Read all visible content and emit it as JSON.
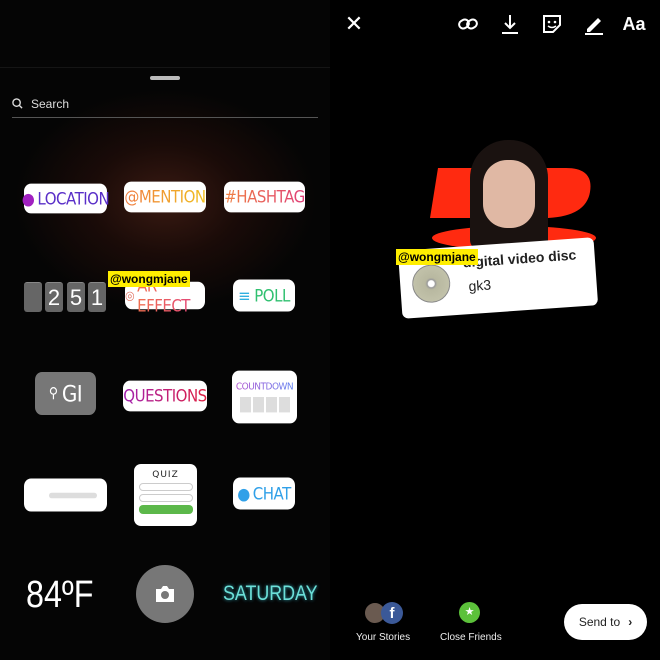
{
  "sticker_tray": {
    "search_placeholder": "Search",
    "stickers": {
      "location": "LOCATION",
      "mention": "@MENTION",
      "hashtag": "#HASHTAG",
      "countdown_digits": [
        "2",
        "5",
        "1"
      ],
      "ar_effect": "AR EFFECT",
      "poll": "POLL",
      "gif": "GI",
      "questions": "QUESTIONS",
      "countdown": "COUNTDOWN",
      "emoji_slider_emoji": "😍",
      "quiz": "QUIZ",
      "chat": "CHAT",
      "temperature": "84ºF",
      "day": "SATURDAY"
    },
    "mention_tag": "@wongmjane"
  },
  "editor": {
    "toolbar": [
      "close-icon",
      "link-icon",
      "download-icon",
      "sticker-icon",
      "draw-icon",
      "text-icon"
    ],
    "text_tool_label": "Aa",
    "card": {
      "mention": "@wongmjane",
      "title": "digital video disc",
      "subtitle": "gk3"
    },
    "footer": {
      "your_stories": "Your Stories",
      "close_friends": "Close Friends",
      "send_to": "Send to"
    },
    "colors": {
      "dvd_red": "#ff2a10",
      "mention_yellow": "#ffee00",
      "close_friends_green": "#5cc13a"
    }
  }
}
